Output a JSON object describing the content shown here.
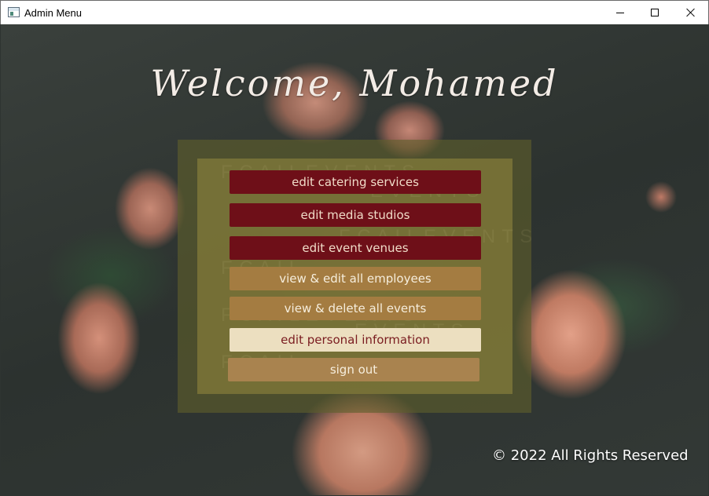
{
  "window": {
    "title": "Admin Menu",
    "controls": {
      "minimize": "minimize-icon",
      "maximize": "maximize-icon",
      "close": "close-icon"
    }
  },
  "header": {
    "welcome": "Welcome, Mohamed"
  },
  "menu": {
    "items": [
      {
        "label": "edit catering services",
        "style": "red"
      },
      {
        "label": "edit media studios",
        "style": "red"
      },
      {
        "label": "edit event venues",
        "style": "red"
      },
      {
        "label": "view & edit all employees",
        "style": "gold"
      },
      {
        "label": "view & delete all events",
        "style": "gold"
      },
      {
        "label": "edit personal information",
        "style": "cream"
      },
      {
        "label": "sign out",
        "style": "soft"
      }
    ]
  },
  "footer": {
    "copyright": "© 2022 All Rights Reserved"
  },
  "colors": {
    "red_button": "#6e0f18",
    "gold_button": "#a47c41",
    "cream_button": "#ecdfc0",
    "panel": "#7d7638"
  }
}
